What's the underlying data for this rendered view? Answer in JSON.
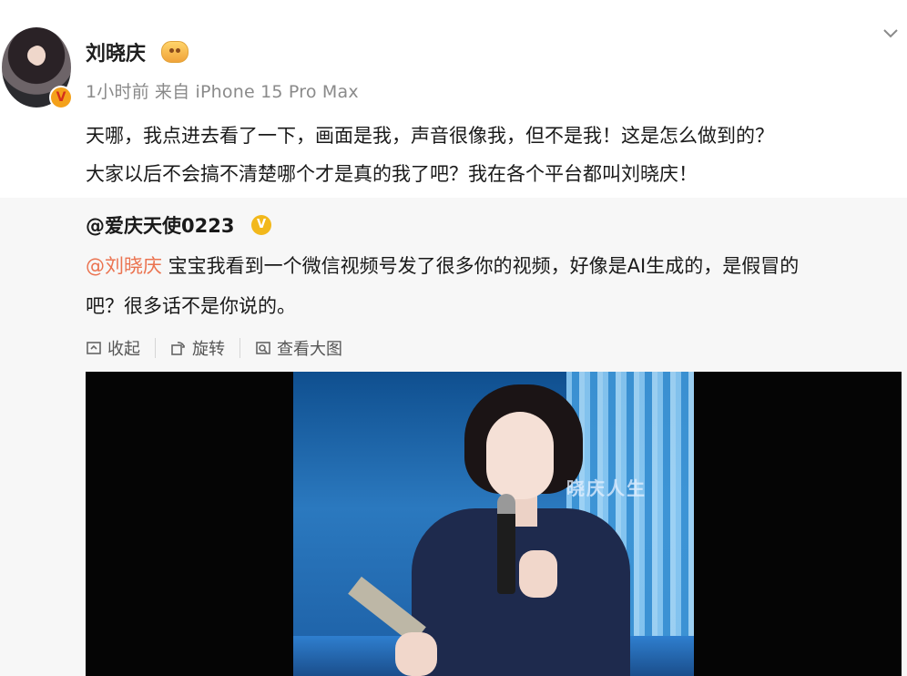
{
  "post": {
    "username": "刘晓庆",
    "time": "1小时前",
    "source": "来自 iPhone 15 Pro Max",
    "text_line1": "天哪，我点进去看了一下，画面是我，声音很像我，但不是我！这是怎么做到的？",
    "text_line2": "大家以后不会搞不清楚哪个才是真的我了吧？我在各个平台都叫刘晓庆！"
  },
  "repost": {
    "author": "@爱庆天使0223",
    "mention": "@刘晓庆",
    "text_line1_rest": " 宝宝我看到一个微信视频号发了很多你的视频，好像是AI生成的，是假冒的",
    "text_line2": "吧？很多话不是你说的。"
  },
  "actions": {
    "collapse": "收起",
    "rotate": "旋转",
    "view_large": "查看大图"
  },
  "media": {
    "watermark": "晓庆人生"
  },
  "colors": {
    "mention": "#eb7350",
    "repost_bg": "#f7f7f7",
    "verified_gold": "#f2b81b"
  },
  "icons": [
    "chevron-down-icon",
    "collapse-icon",
    "rotate-icon",
    "view-large-icon",
    "verified-icon"
  ]
}
